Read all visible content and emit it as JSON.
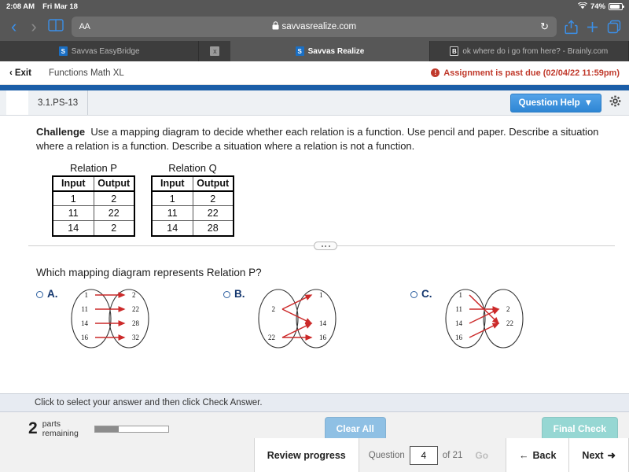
{
  "status_bar": {
    "time": "2:08 AM",
    "date": "Fri Mar 18",
    "battery_percent": "74%",
    "wifi_icon": "wifi-icon",
    "battery_icon": "battery-icon"
  },
  "browser": {
    "back_icon": "chevron-left-icon",
    "forward_icon": "chevron-right-icon",
    "bookmarks_icon": "book-icon",
    "text_size_label": "AA",
    "lock_icon": "lock-icon",
    "url": "savvasrealize.com",
    "reload_icon": "reload-icon",
    "share_icon": "share-icon",
    "new_tab_icon": "plus-icon",
    "tabs_overview_icon": "tabs-icon",
    "tabs": [
      {
        "title": "Savvas EasyBridge",
        "favicon": "savvas-favicon",
        "active": false
      },
      {
        "title": "Savvas Realize",
        "favicon": "savvas-favicon",
        "active": true
      },
      {
        "title": "ok where do i go from here? - Brainly.com",
        "favicon": "brainly-favicon",
        "active": false
      }
    ],
    "close_tab_label": "x"
  },
  "app_header": {
    "exit_label": "Exit",
    "exit_icon": "chevron-left-icon",
    "course_title": "Functions Math XL",
    "alert_icon": "exclamation-icon",
    "alert_text": "Assignment is past due (02/04/22 11:59pm)",
    "alert_color": "#c0392b"
  },
  "question_toolbar": {
    "question_id": "3.1.PS-13",
    "question_help_label": "Question Help",
    "dropdown_icon": "caret-down-icon",
    "settings_icon": "gear-icon",
    "accent_color": "#2e86d4"
  },
  "problem": {
    "label": "Challenge",
    "text": "Use a mapping diagram to decide whether each relation is a function. Use pencil and paper. Describe a situation where a relation is a function. Describe a situation where a relation is not a function.",
    "tables": [
      {
        "caption": "Relation P",
        "headers": [
          "Input",
          "Output"
        ],
        "rows": [
          [
            "1",
            "2"
          ],
          [
            "11",
            "22"
          ],
          [
            "14",
            "2"
          ]
        ]
      },
      {
        "caption": "Relation Q",
        "headers": [
          "Input",
          "Output"
        ],
        "rows": [
          [
            "1",
            "2"
          ],
          [
            "11",
            "22"
          ],
          [
            "14",
            "28"
          ]
        ]
      }
    ]
  },
  "divider": {
    "handle_icon": "drag-handle-icon"
  },
  "question": {
    "prompt": "Which mapping diagram represents Relation P?",
    "choices": [
      {
        "letter": "A.",
        "selected": false,
        "diagram": {
          "left_values": [
            "1",
            "11",
            "14",
            "16"
          ],
          "right_values": [
            "2",
            "22",
            "28",
            "32"
          ],
          "mappings": [
            [
              0,
              0
            ],
            [
              1,
              1
            ],
            [
              2,
              2
            ],
            [
              3,
              3
            ]
          ],
          "arrow_color": "#cc2a2a"
        }
      },
      {
        "letter": "B.",
        "selected": false,
        "diagram": {
          "left_values": [
            "",
            "2",
            "",
            "22"
          ],
          "right_values": [
            "1",
            "",
            "14",
            "16"
          ],
          "mappings": [
            [
              1,
              0
            ],
            [
              1,
              2
            ],
            [
              3,
              2
            ],
            [
              3,
              3
            ]
          ],
          "arrow_color": "#cc2a2a"
        }
      },
      {
        "letter": "C.",
        "selected": false,
        "diagram": {
          "left_values": [
            "1",
            "11",
            "14",
            "16"
          ],
          "right_values": [
            "",
            "2",
            "22",
            ""
          ],
          "mappings": [
            [
              0,
              2
            ],
            [
              1,
              1
            ],
            [
              2,
              1
            ],
            [
              3,
              2
            ]
          ],
          "arrow_color": "#cc2a2a"
        }
      }
    ]
  },
  "instruction": {
    "text": "Click to select your answer and then click Check Answer."
  },
  "parts_bar": {
    "count": "2",
    "label_line1": "parts",
    "label_line2": "remaining",
    "progress_percent": 33,
    "clear_all_label": "Clear All",
    "final_check_label": "Final Check"
  },
  "bottom_nav": {
    "review_progress_label": "Review progress",
    "question_label": "Question",
    "question_number": "4",
    "of_label": "of 21",
    "go_label": "Go",
    "back_label": "Back",
    "back_icon": "arrow-left-icon",
    "next_label": "Next",
    "next_icon": "arrow-right-icon"
  }
}
